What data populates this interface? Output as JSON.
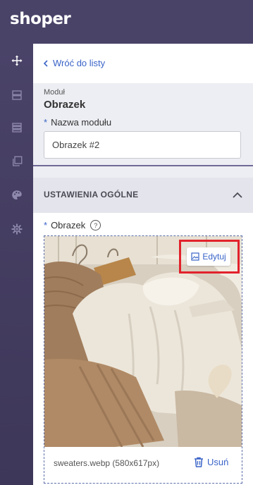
{
  "app": {
    "logo": "shoper"
  },
  "sidebar": {
    "items": [
      {
        "name": "move",
        "icon": "move-arrows-icon",
        "active": true
      },
      {
        "name": "layout",
        "icon": "layout-rows-icon",
        "active": false
      },
      {
        "name": "sections",
        "icon": "list-lines-icon",
        "active": false
      },
      {
        "name": "pages",
        "icon": "copy-pages-icon",
        "active": false
      },
      {
        "name": "styles",
        "icon": "palette-icon",
        "active": false
      },
      {
        "name": "settings",
        "icon": "gear-icon",
        "active": false
      }
    ]
  },
  "panel": {
    "back_label": "Wróć do listy",
    "module_caption": "Moduł",
    "module_title": "Obrazek",
    "name_label": "Nazwa modułu",
    "name_value": "Obrazek #2",
    "required_mark": "*",
    "section_title": "USTAWIENIA OGÓLNE",
    "image_label": "Obrazek",
    "help_glyph": "?",
    "edit_label": "Edytuj",
    "file_name": "sweaters.webp (580x617px)",
    "remove_label": "Usuń"
  },
  "colors": {
    "brand": "#4a4368",
    "accent": "#3a64c8",
    "highlight": "#e2222c"
  }
}
